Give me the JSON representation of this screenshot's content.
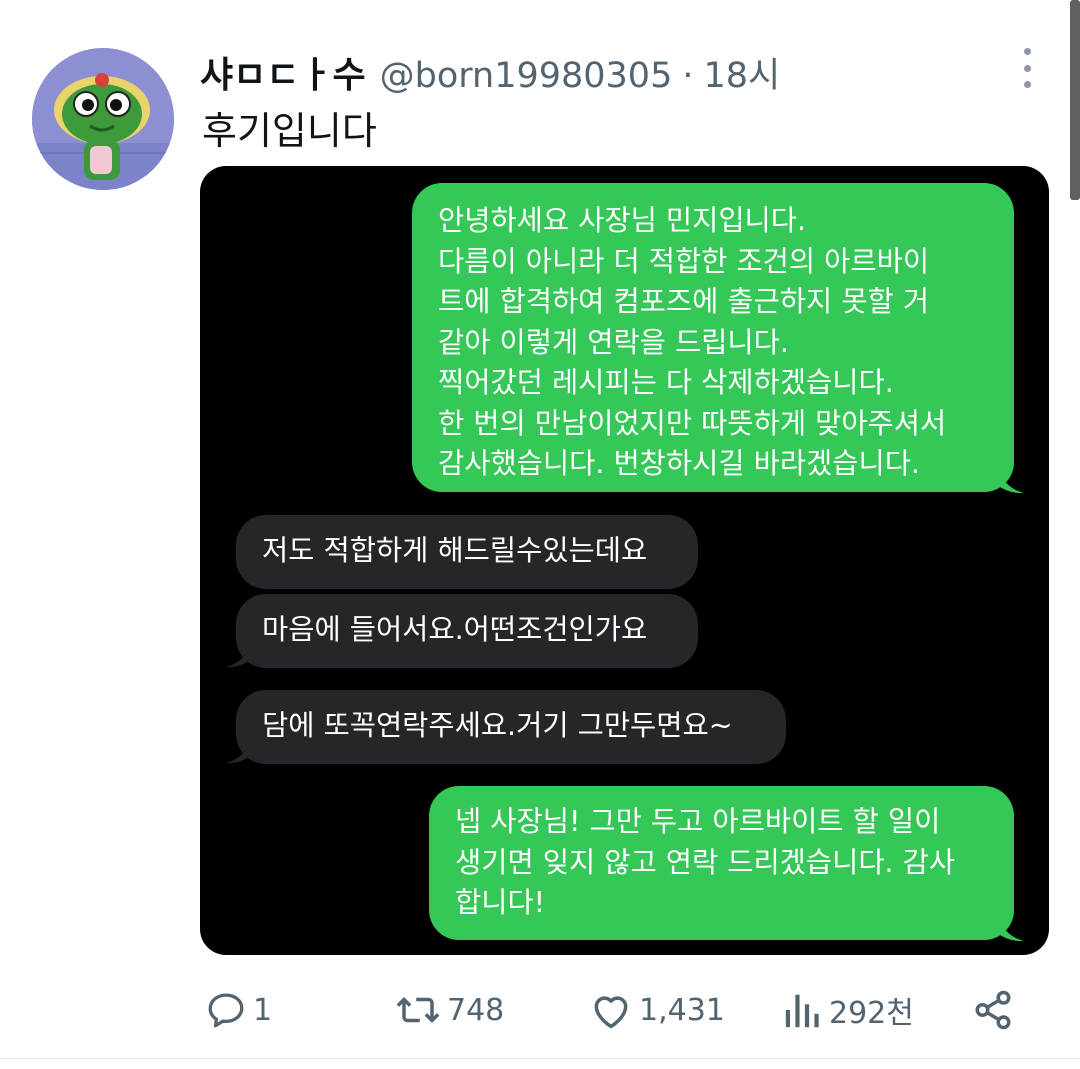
{
  "tweet": {
    "display_name": "샤ㅁㄷㅏ수",
    "handle": "@born19980305",
    "separator": "·",
    "time": "18시",
    "text": "후기입니다"
  },
  "media": {
    "messages": [
      {
        "from": "me",
        "lines": [
          "안녕하세요 사장님 민지입니다.",
          "다름이 아니라 더 적합한 조건의 아르바이",
          "트에 합격하여 컴포즈에 출근하지 못할 거",
          "같아 이렇게 연락을 드립니다.",
          "찍어갔던 레시피는 다 삭제하겠습니다.",
          "한 번의 만남이었지만 따뜻하게 맞아주셔서",
          "감사했습니다. 번창하시길 바라겠습니다."
        ]
      },
      {
        "from": "them",
        "lines": [
          "저도 적합하게 해드릴수있는데요"
        ]
      },
      {
        "from": "them",
        "lines": [
          "마음에 들어서요.어떤조건인가요"
        ]
      },
      {
        "from": "them",
        "lines": [
          "담에 또꼭연락주세요.거기 그만두면요~"
        ]
      },
      {
        "from": "me",
        "lines": [
          "넵 사장님! 그만 두고 아르바이트 할 일이",
          "생기면 잊지 않고 연락 드리겠습니다. 감사",
          "합니다!"
        ]
      }
    ]
  },
  "actions": {
    "reply_count": "1",
    "retweet_count": "748",
    "like_count": "1,431",
    "views_count": "292천"
  },
  "colors": {
    "sent_bubble": "#35c858",
    "received_bubble": "#26262a",
    "muted_text": "#536471"
  }
}
